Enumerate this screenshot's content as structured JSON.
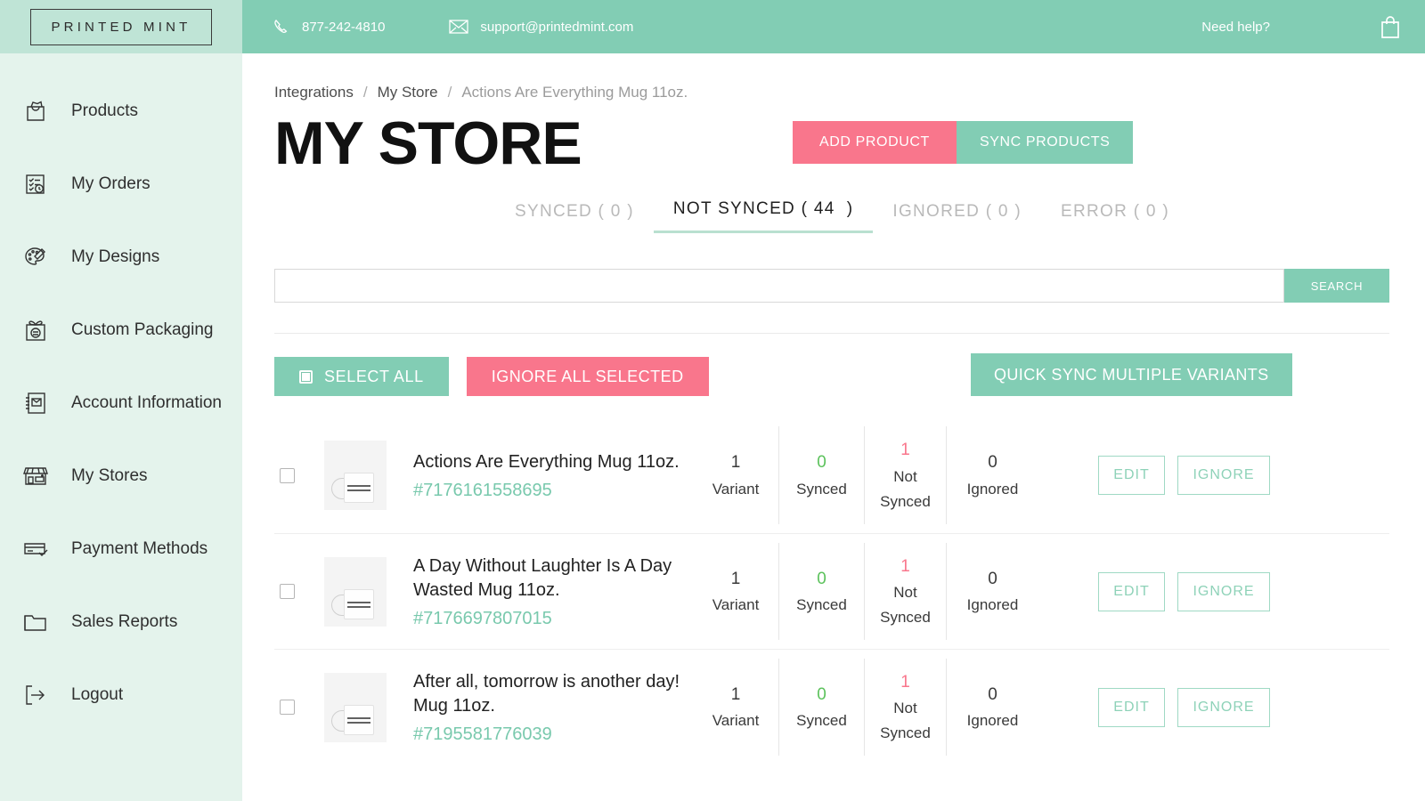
{
  "brand": {
    "logo_text": "PRINTED MINT"
  },
  "topbar": {
    "phone": "877-242-4810",
    "email": "support@printedmint.com",
    "need_help": "Need help?",
    "phone_icon": "phone-icon",
    "email_icon": "envelope-icon",
    "cart_icon": "shopping-bag-icon",
    "background": "#82cdb4"
  },
  "sidebar": {
    "background": "#e4f3ec",
    "items": [
      {
        "label": "Products",
        "icon": "shopping-bag-icon"
      },
      {
        "label": "My Orders",
        "icon": "checklist-clock-icon"
      },
      {
        "label": "My Designs",
        "icon": "palette-brush-icon"
      },
      {
        "label": "Custom Packaging",
        "icon": "gift-box-icon"
      },
      {
        "label": "Account Information",
        "icon": "address-book-icon"
      },
      {
        "label": "My Stores",
        "icon": "storefront-icon"
      },
      {
        "label": "Payment Methods",
        "icon": "credit-card-check-icon"
      },
      {
        "label": "Sales Reports",
        "icon": "folder-icon"
      },
      {
        "label": "Logout",
        "icon": "logout-arrow-icon"
      }
    ]
  },
  "breadcrumb": {
    "root": "Integrations",
    "sep": "/",
    "parent": "My Store",
    "current": "Actions Are Everything Mug 11oz."
  },
  "header": {
    "title": "MY STORE",
    "add_product": "ADD PRODUCT",
    "sync_products": "SYNC PRODUCTS",
    "add_product_color": "#f9768c",
    "sync_products_color": "#82cdb4"
  },
  "tabs": [
    {
      "label": "SYNCED ( 0 )",
      "active": false
    },
    {
      "label": "NOT SYNCED ( 44  )",
      "active": true
    },
    {
      "label": "IGNORED ( 0 )",
      "active": false
    },
    {
      "label": "ERROR ( 0 )",
      "active": false
    }
  ],
  "search": {
    "value": "",
    "placeholder": "",
    "button": "SEARCH"
  },
  "actions": {
    "select_all": "SELECT ALL",
    "ignore_all_selected": "IGNORE ALL SELECTED",
    "quick_sync": "QUICK SYNC MULTIPLE VARIANTS"
  },
  "row_labels": {
    "variant": "Variant",
    "synced": "Synced",
    "not": "Not",
    "not_synced": "Synced",
    "ignored": "Ignored",
    "edit": "EDIT",
    "ignore": "IGNORE"
  },
  "products": [
    {
      "name": "Actions Are Everything Mug 11oz.",
      "id": "#7176161558695",
      "variants": "1",
      "synced": "0",
      "not_synced": "1",
      "ignored": "0"
    },
    {
      "name": "A Day Without Laughter Is A Day Wasted Mug 11oz.",
      "id": "#7176697807015",
      "variants": "1",
      "synced": "0",
      "not_synced": "1",
      "ignored": "0"
    },
    {
      "name": "After all, tomorrow is another day! Mug 11oz.",
      "id": "#7195581776039",
      "variants": "1",
      "synced": "0",
      "not_synced": "1",
      "ignored": "0"
    }
  ]
}
